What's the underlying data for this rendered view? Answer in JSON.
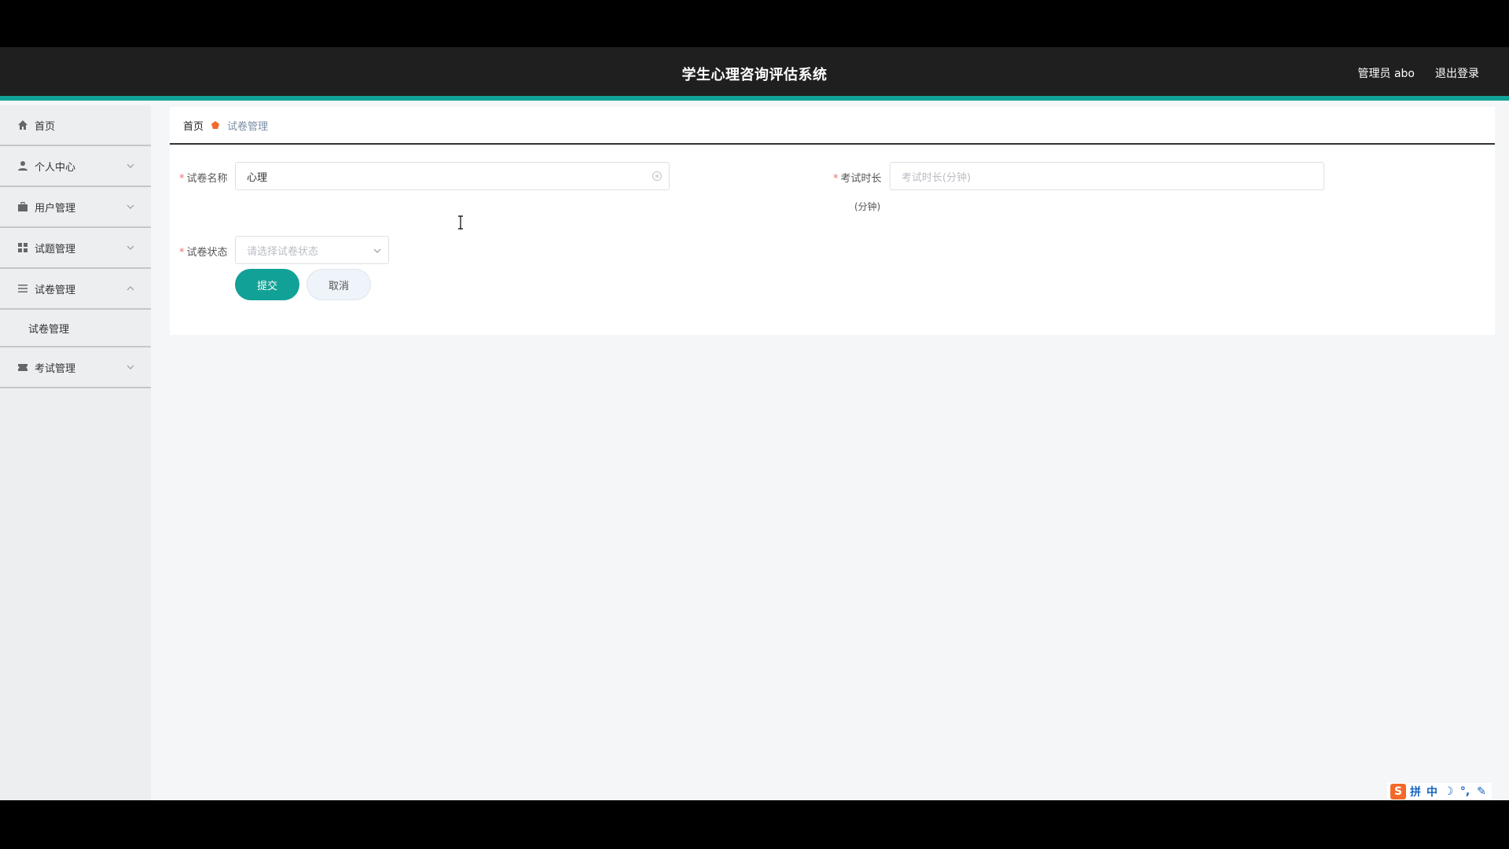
{
  "header": {
    "title": "学生心理咨询评估系统",
    "user_label": "管理员 abo",
    "logout_label": "退出登录"
  },
  "sidebar": {
    "items": [
      {
        "label": "首页",
        "icon": "home-icon"
      },
      {
        "label": "个人中心",
        "icon": "user-icon"
      },
      {
        "label": "用户管理",
        "icon": "briefcase-icon"
      },
      {
        "label": "试题管理",
        "icon": "grid-icon"
      },
      {
        "label": "试卷管理",
        "icon": "list-icon",
        "expanded": true,
        "children": [
          {
            "label": "试卷管理"
          }
        ]
      },
      {
        "label": "考试管理",
        "icon": "ticket-icon"
      }
    ]
  },
  "breadcrumb": {
    "home": "首页",
    "current": "试卷管理"
  },
  "form": {
    "name": {
      "label": "试卷名称",
      "value": "心理"
    },
    "duration": {
      "label": "考试时长",
      "placeholder": "考试时长(分钟)",
      "unit": "(分钟)"
    },
    "status": {
      "label": "试卷状态",
      "placeholder": "请选择试卷状态"
    },
    "submit_label": "提交",
    "cancel_label": "取消"
  },
  "ime_toolbar": {
    "logo": "S",
    "items": [
      "拼",
      "中",
      "☽",
      "°,",
      "✎"
    ]
  },
  "colors": {
    "accent": "#12a196",
    "header_bg": "#1f1f1f",
    "required": "#f56c6c"
  }
}
